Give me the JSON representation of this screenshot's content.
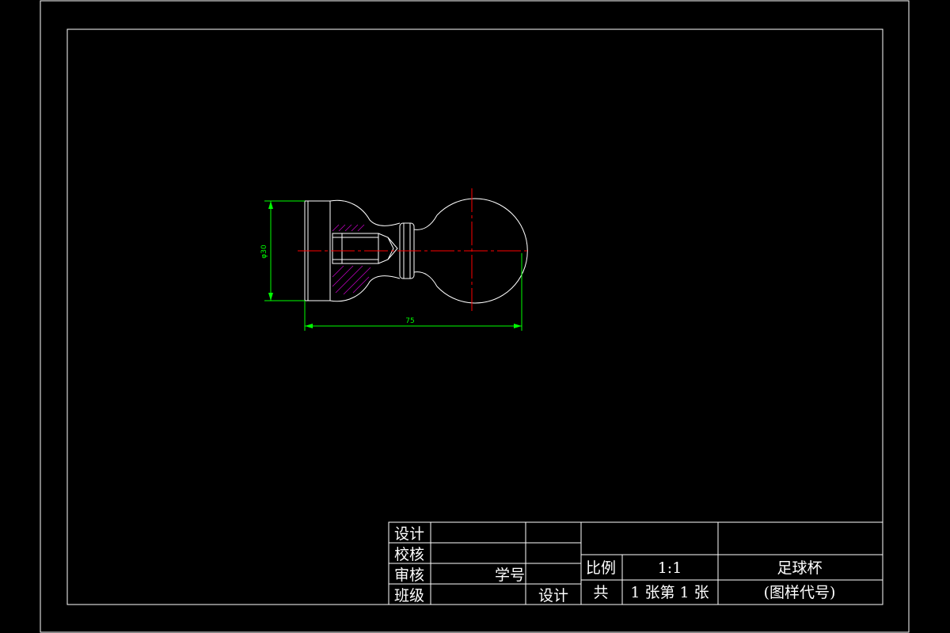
{
  "drawing": {
    "dimensions": {
      "overall_length": "75",
      "height": "φ30"
    }
  },
  "title_block": {
    "labels": {
      "design": "设计",
      "proofread": "校核",
      "review": "审核",
      "class": "班级",
      "student_no": "学号",
      "design2": "设计",
      "scale": "比例",
      "total": "共"
    },
    "values": {
      "scale_value": "1:1",
      "sheets": "1 张第 1 张",
      "part_name": "足球杯",
      "drawing_no": "(图样代号)"
    }
  },
  "colors": {
    "background": "#000000",
    "outline": "#ffffff",
    "dimension": "#00ff00",
    "centerline": "#ff0000",
    "hatch": "#c000c0"
  }
}
